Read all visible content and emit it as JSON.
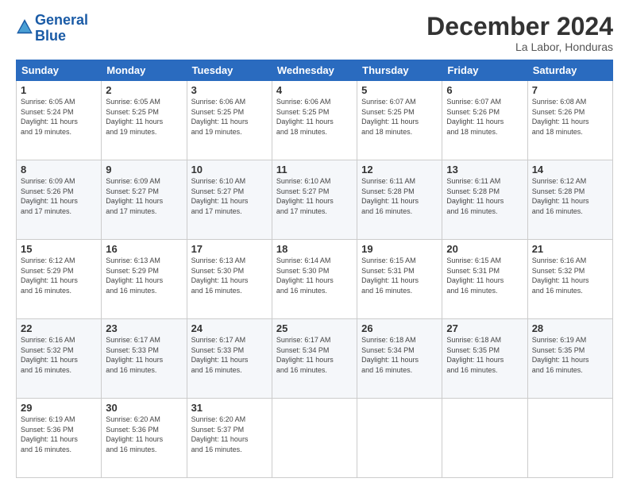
{
  "logo": {
    "line1": "General",
    "line2": "Blue"
  },
  "title": "December 2024",
  "subtitle": "La Labor, Honduras",
  "days_header": [
    "Sunday",
    "Monday",
    "Tuesday",
    "Wednesday",
    "Thursday",
    "Friday",
    "Saturday"
  ],
  "weeks": [
    [
      {
        "day": "1",
        "info": "Sunrise: 6:05 AM\nSunset: 5:24 PM\nDaylight: 11 hours\nand 19 minutes."
      },
      {
        "day": "2",
        "info": "Sunrise: 6:05 AM\nSunset: 5:25 PM\nDaylight: 11 hours\nand 19 minutes."
      },
      {
        "day": "3",
        "info": "Sunrise: 6:06 AM\nSunset: 5:25 PM\nDaylight: 11 hours\nand 19 minutes."
      },
      {
        "day": "4",
        "info": "Sunrise: 6:06 AM\nSunset: 5:25 PM\nDaylight: 11 hours\nand 18 minutes."
      },
      {
        "day": "5",
        "info": "Sunrise: 6:07 AM\nSunset: 5:25 PM\nDaylight: 11 hours\nand 18 minutes."
      },
      {
        "day": "6",
        "info": "Sunrise: 6:07 AM\nSunset: 5:26 PM\nDaylight: 11 hours\nand 18 minutes."
      },
      {
        "day": "7",
        "info": "Sunrise: 6:08 AM\nSunset: 5:26 PM\nDaylight: 11 hours\nand 18 minutes."
      }
    ],
    [
      {
        "day": "8",
        "info": "Sunrise: 6:09 AM\nSunset: 5:26 PM\nDaylight: 11 hours\nand 17 minutes."
      },
      {
        "day": "9",
        "info": "Sunrise: 6:09 AM\nSunset: 5:27 PM\nDaylight: 11 hours\nand 17 minutes."
      },
      {
        "day": "10",
        "info": "Sunrise: 6:10 AM\nSunset: 5:27 PM\nDaylight: 11 hours\nand 17 minutes."
      },
      {
        "day": "11",
        "info": "Sunrise: 6:10 AM\nSunset: 5:27 PM\nDaylight: 11 hours\nand 17 minutes."
      },
      {
        "day": "12",
        "info": "Sunrise: 6:11 AM\nSunset: 5:28 PM\nDaylight: 11 hours\nand 16 minutes."
      },
      {
        "day": "13",
        "info": "Sunrise: 6:11 AM\nSunset: 5:28 PM\nDaylight: 11 hours\nand 16 minutes."
      },
      {
        "day": "14",
        "info": "Sunrise: 6:12 AM\nSunset: 5:28 PM\nDaylight: 11 hours\nand 16 minutes."
      }
    ],
    [
      {
        "day": "15",
        "info": "Sunrise: 6:12 AM\nSunset: 5:29 PM\nDaylight: 11 hours\nand 16 minutes."
      },
      {
        "day": "16",
        "info": "Sunrise: 6:13 AM\nSunset: 5:29 PM\nDaylight: 11 hours\nand 16 minutes."
      },
      {
        "day": "17",
        "info": "Sunrise: 6:13 AM\nSunset: 5:30 PM\nDaylight: 11 hours\nand 16 minutes."
      },
      {
        "day": "18",
        "info": "Sunrise: 6:14 AM\nSunset: 5:30 PM\nDaylight: 11 hours\nand 16 minutes."
      },
      {
        "day": "19",
        "info": "Sunrise: 6:15 AM\nSunset: 5:31 PM\nDaylight: 11 hours\nand 16 minutes."
      },
      {
        "day": "20",
        "info": "Sunrise: 6:15 AM\nSunset: 5:31 PM\nDaylight: 11 hours\nand 16 minutes."
      },
      {
        "day": "21",
        "info": "Sunrise: 6:16 AM\nSunset: 5:32 PM\nDaylight: 11 hours\nand 16 minutes."
      }
    ],
    [
      {
        "day": "22",
        "info": "Sunrise: 6:16 AM\nSunset: 5:32 PM\nDaylight: 11 hours\nand 16 minutes."
      },
      {
        "day": "23",
        "info": "Sunrise: 6:17 AM\nSunset: 5:33 PM\nDaylight: 11 hours\nand 16 minutes."
      },
      {
        "day": "24",
        "info": "Sunrise: 6:17 AM\nSunset: 5:33 PM\nDaylight: 11 hours\nand 16 minutes."
      },
      {
        "day": "25",
        "info": "Sunrise: 6:17 AM\nSunset: 5:34 PM\nDaylight: 11 hours\nand 16 minutes."
      },
      {
        "day": "26",
        "info": "Sunrise: 6:18 AM\nSunset: 5:34 PM\nDaylight: 11 hours\nand 16 minutes."
      },
      {
        "day": "27",
        "info": "Sunrise: 6:18 AM\nSunset: 5:35 PM\nDaylight: 11 hours\nand 16 minutes."
      },
      {
        "day": "28",
        "info": "Sunrise: 6:19 AM\nSunset: 5:35 PM\nDaylight: 11 hours\nand 16 minutes."
      }
    ],
    [
      {
        "day": "29",
        "info": "Sunrise: 6:19 AM\nSunset: 5:36 PM\nDaylight: 11 hours\nand 16 minutes."
      },
      {
        "day": "30",
        "info": "Sunrise: 6:20 AM\nSunset: 5:36 PM\nDaylight: 11 hours\nand 16 minutes."
      },
      {
        "day": "31",
        "info": "Sunrise: 6:20 AM\nSunset: 5:37 PM\nDaylight: 11 hours\nand 16 minutes."
      },
      null,
      null,
      null,
      null
    ]
  ]
}
